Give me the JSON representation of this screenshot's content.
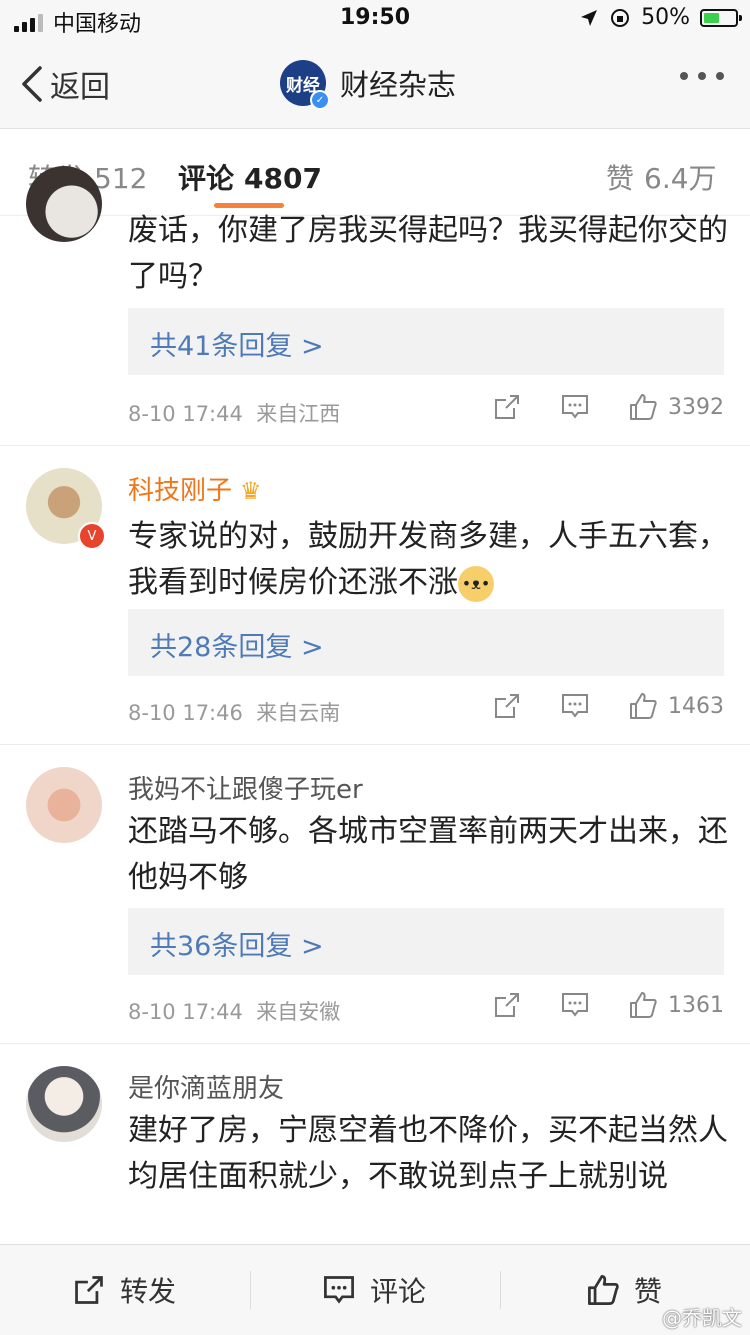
{
  "status_bar": {
    "carrier": "中国移动",
    "time": "19:50",
    "battery": "50%",
    "battery_level": 0.5
  },
  "nav": {
    "back_label": "返回",
    "logo_text": "财经",
    "title": "财经杂志"
  },
  "tabs": [
    {
      "label": "转发",
      "count": "512"
    },
    {
      "label": "评论",
      "count": "4807"
    },
    {
      "label": "赞",
      "count": "6.4万"
    }
  ],
  "comments": [
    {
      "name": "",
      "text": "废话，你建了房我买得起吗？我买得起你交的了吗？",
      "replies": "共41条回复 >",
      "time": "8-10 17:44",
      "source": "来自江西",
      "likes": "3392"
    },
    {
      "name": "科技刚子",
      "text": "专家说的对，鼓励开发商多建，人手五六套，我看到时候房价还涨不涨",
      "replies": "共28条回复 >",
      "time": "8-10 17:46",
      "source": "来自云南",
      "likes": "1463"
    },
    {
      "name": "我妈不让跟傻子玩er",
      "text": "还踏马不够。各城市空置率前两天才出来，还他妈不够",
      "replies": "共36条回复 >",
      "time": "8-10 17:44",
      "source": "来自安徽",
      "likes": "1361"
    },
    {
      "name": "是你滴蓝朋友",
      "text": "建好了房，宁愿空着也不降价，买不起当然人均居住面积就少，不敢说到点子上就别说"
    }
  ],
  "bottom_bar": {
    "repost": "转发",
    "comment": "评论",
    "like": "赞"
  },
  "watermark": "@乔凯文",
  "colors": {
    "accent_orange": "#f7813b",
    "link_blue": "#4e7bb8",
    "vip_name_orange": "#f0761b"
  }
}
